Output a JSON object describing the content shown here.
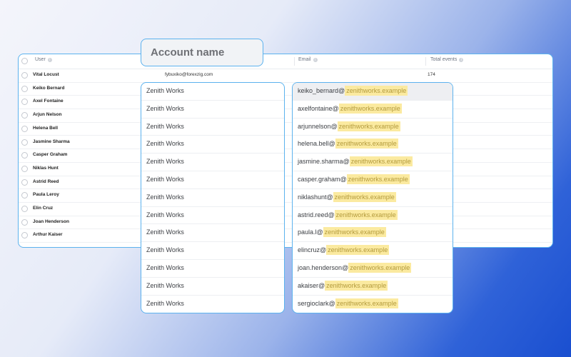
{
  "table": {
    "headers": {
      "user": "User",
      "email": "Email",
      "total_events": "Total events"
    },
    "rows": [
      {
        "user": "Vital Locust",
        "account_email": "fybuxiko@forexzig.com",
        "total_events": "174"
      },
      {
        "user": "Keiko Bernard"
      },
      {
        "user": "Axel Fontaine"
      },
      {
        "user": "Arjun Nelson"
      },
      {
        "user": "Helena Bell"
      },
      {
        "user": "Jasmine Sharma"
      },
      {
        "user": "Casper Graham"
      },
      {
        "user": "Niklas Hunt"
      },
      {
        "user": "Astrid Reed"
      },
      {
        "user": "Paula Leroy"
      },
      {
        "user": "Elin Cruz"
      },
      {
        "user": "Joan Henderson"
      },
      {
        "user": "Arthur Kaiser"
      }
    ]
  },
  "account_overlay": {
    "label": "Account name",
    "items": [
      "Zenith Works",
      "Zenith Works",
      "Zenith Works",
      "Zenith Works",
      "Zenith Works",
      "Zenith Works",
      "Zenith Works",
      "Zenith Works",
      "Zenith Works",
      "Zenith Works",
      "Zenith Works",
      "Zenith Works",
      "Zenith Works"
    ]
  },
  "email_overlay": {
    "items": [
      {
        "local": "keiko_bernard@",
        "domain": "zenithworks.example"
      },
      {
        "local": "axelfontaine@",
        "domain": "zenithworks.example"
      },
      {
        "local": "arjunnelson@",
        "domain": "zenithworks.example"
      },
      {
        "local": "helena.bell@",
        "domain": "zenithworks.example"
      },
      {
        "local": "jasmine.sharma@",
        "domain": "zenithworks.example"
      },
      {
        "local": "casper.graham@",
        "domain": "zenithworks.example"
      },
      {
        "local": "niklashunt@",
        "domain": "zenithworks.example"
      },
      {
        "local": "astrid.reed@",
        "domain": "zenithworks.example"
      },
      {
        "local": "paula.l@",
        "domain": "zenithworks.example"
      },
      {
        "local": "elincruz@",
        "domain": "zenithworks.example"
      },
      {
        "local": "joan.henderson@",
        "domain": "zenithworks.example"
      },
      {
        "local": "akaiser@",
        "domain": "zenithworks.example"
      },
      {
        "local": "sergioclark@",
        "domain": "zenithworks.example"
      }
    ]
  },
  "colors": {
    "accent_border": "#5cb2ee",
    "highlight": "#fbeaa0",
    "highlight_text": "#b39a3c"
  }
}
